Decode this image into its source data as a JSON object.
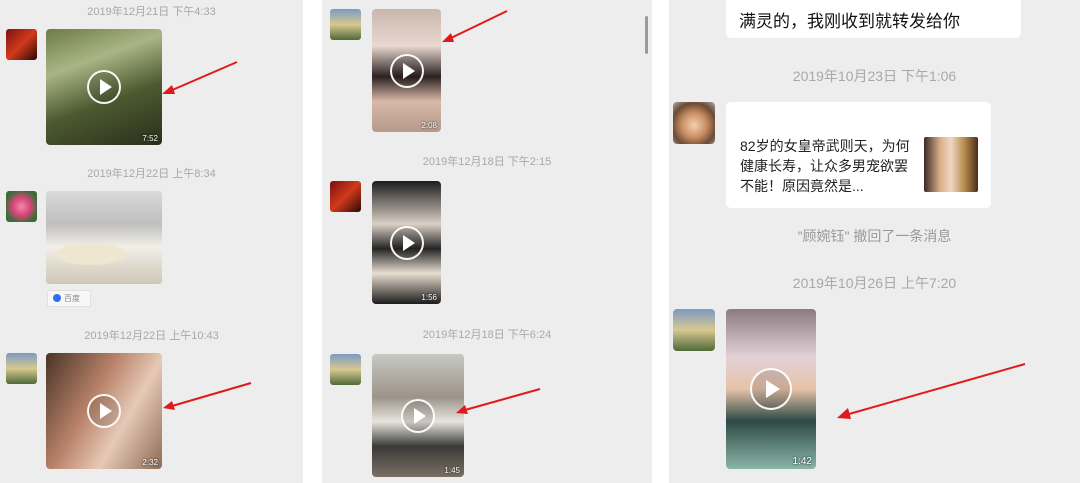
{
  "panel1": {
    "timestamps": [
      "2019年12月21日 下午4:33",
      "2019年12月22日 上午8:34",
      "2019年12月22日 上午10:43"
    ],
    "durations": [
      "7:52",
      "2:32"
    ],
    "source_label": "百度"
  },
  "panel2": {
    "timestamps": [
      "2019年12月18日 下午2:15",
      "2019年12月18日 下午6:24"
    ],
    "durations": [
      "2:08",
      "1:56",
      "1:45"
    ]
  },
  "panel3": {
    "top_message": "满灵的，我刚收到就转发给你",
    "timestamps": [
      "2019年10月23日 下午1:06",
      "2019年10月26日 上午7:20"
    ],
    "link_card_title": "82岁的女皇帝武则天，为何健康长寿，让众多男宠欲罢不能！原因竟然是...",
    "recall_notice": "\"顾婉钰\" 撤回了一条消息",
    "durations": [
      "1:42"
    ]
  },
  "colors": {
    "background": "#ededed",
    "arrow": "#e01a1a",
    "timestamp": "#a8a8a8"
  },
  "icons": [
    "play-icon",
    "baidu-paw-icon"
  ]
}
